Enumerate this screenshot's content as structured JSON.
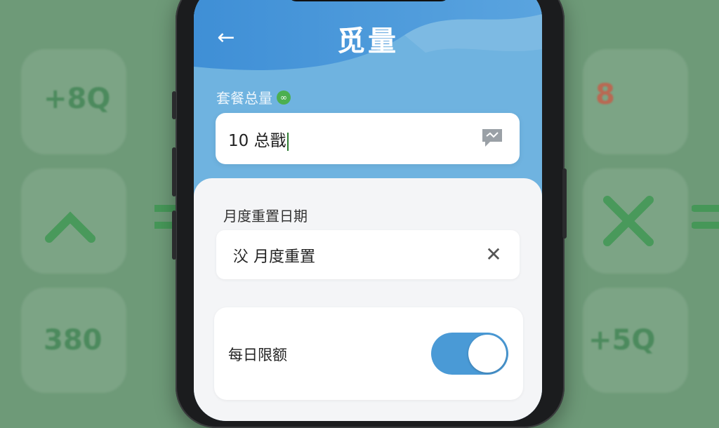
{
  "header": {
    "title": "觅量",
    "back_icon": "arrow-left-icon"
  },
  "total_plan": {
    "label": "套餐总量",
    "value": "10 总戬",
    "badge_icon": "link-icon",
    "action_icon": "message-icon"
  },
  "monthly_reset": {
    "label": "月度重置日期",
    "value": "㳇 月度重置",
    "clear_icon": "close-icon"
  },
  "daily_limit": {
    "label": "每日限额",
    "enabled": true
  },
  "background": {
    "glyphs": [
      "+8Q",
      "8",
      "380",
      "+5Q"
    ]
  },
  "colors": {
    "header_blue": "#6fb3e0",
    "toggle_on": "#4a9ad6",
    "background_green": "#6e9a78"
  }
}
